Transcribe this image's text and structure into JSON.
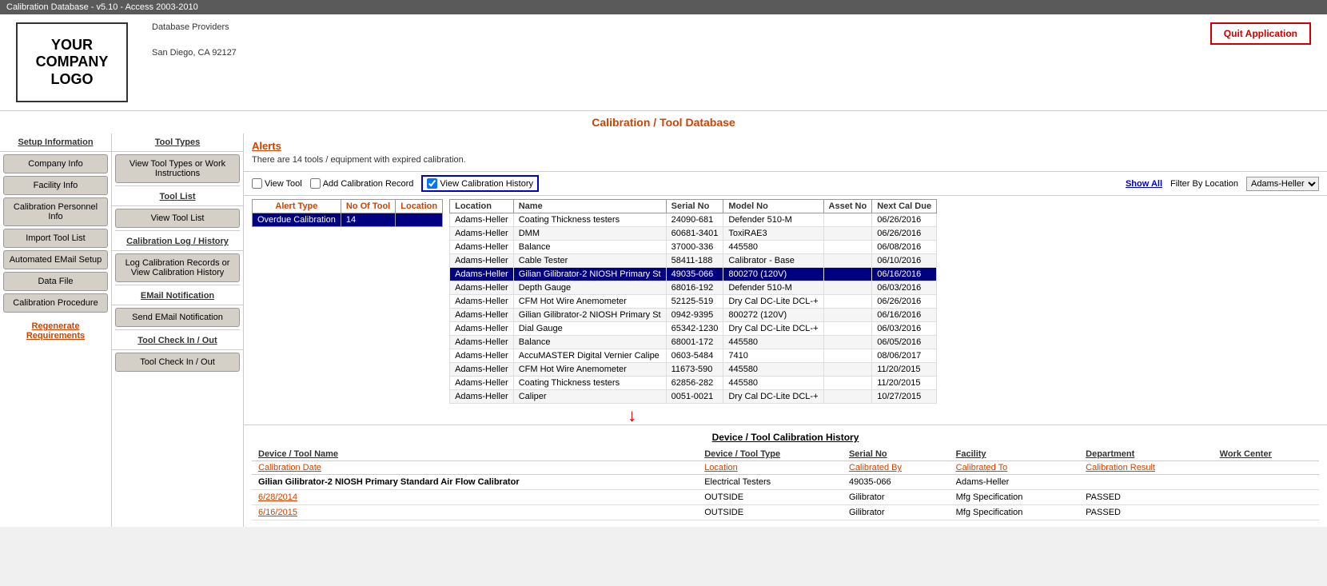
{
  "titleBar": {
    "text": "Calibration Database - v5.10 - Access 2003-2010"
  },
  "header": {
    "logo": "YOUR\nCOMPANY\nLOGO",
    "dbProviders": "Database Providers",
    "address": "San Diego,  CA  92127",
    "quitButton": "Quit Application"
  },
  "pageTitle": "Calibration / Tool Database",
  "leftSidebar": {
    "sectionHeader": "Setup Information",
    "buttons": [
      "Company Info",
      "Facility Info",
      "Calibration Personnel Info",
      "Import Tool List",
      "Automated EMail Setup",
      "Data File",
      "Calibration Procedure"
    ],
    "regenLink": "Regenerate Requirements"
  },
  "middleSidebar": {
    "toolTypesHeader": "Tool Types",
    "toolTypesBtn": "View Tool Types or Work Instructions",
    "toolListHeader": "Tool List",
    "toolListBtn": "View Tool List",
    "calLogHeader": "Calibration Log / History",
    "calLogBtn": "Log Calibration Records or View Calibration History",
    "emailHeader": "EMail Notification",
    "emailBtn": "Send EMail Notification",
    "toolCheckHeader1": "Tool Check In / Out",
    "toolCheckBtn1": "Tool Check In / Out"
  },
  "alerts": {
    "title": "Alerts",
    "message": "There are 14 tools / equipment with expired calibration."
  },
  "controls": {
    "viewToolLabel": "View Tool",
    "addCalRecordLabel": "Add Calibration Record",
    "viewCalHistoryLabel": "View Calibration History",
    "showAllLabel": "Show All",
    "filterByLocationLabel": "Filter By Location",
    "filterValue": "Adams-Heller"
  },
  "alertTable": {
    "headers": [
      "Alert Type",
      "No Of Tool",
      "Location"
    ],
    "rows": [
      {
        "type": "Overdue Calibration",
        "count": "14",
        "location": "",
        "selected": true
      }
    ]
  },
  "dataTable": {
    "headers": [
      "Name",
      "Serial No",
      "Model No",
      "Asset No",
      "Next Cal Due"
    ],
    "locationHeader": "Location",
    "rows": [
      {
        "location": "Adams-Heller",
        "name": "Coating Thickness testers",
        "serial": "24090-681",
        "model": "Defender 510-M",
        "asset": "",
        "nextCal": "06/26/2016"
      },
      {
        "location": "Adams-Heller",
        "name": "DMM",
        "serial": "60681-3401",
        "model": "ToxiRAE3",
        "asset": "",
        "nextCal": "06/26/2016"
      },
      {
        "location": "Adams-Heller",
        "name": "Balance",
        "serial": "37000-336",
        "model": "445580",
        "asset": "",
        "nextCal": "06/08/2016"
      },
      {
        "location": "Adams-Heller",
        "name": "Cable Tester",
        "serial": "58411-188",
        "model": "Calibrator - Base",
        "asset": "",
        "nextCal": "06/10/2016"
      },
      {
        "location": "Adams-Heller",
        "name": "Gilian Gilibrator-2 NIOSH Primary St",
        "serial": "49035-066",
        "model": "800270 (120V)",
        "asset": "",
        "nextCal": "06/16/2016",
        "selected": true
      },
      {
        "location": "Adams-Heller",
        "name": "Depth Gauge",
        "serial": "68016-192",
        "model": "Defender 510-M",
        "asset": "",
        "nextCal": "06/03/2016"
      },
      {
        "location": "Adams-Heller",
        "name": "CFM Hot Wire Anemometer",
        "serial": "52125-519",
        "model": "Dry Cal DC-Lite DCL-+",
        "asset": "",
        "nextCal": "06/26/2016"
      },
      {
        "location": "Adams-Heller",
        "name": "Gilian Gilibrator-2 NIOSH Primary St",
        "serial": "0942-9395",
        "model": "800272 (120V)",
        "asset": "",
        "nextCal": "06/16/2016"
      },
      {
        "location": "Adams-Heller",
        "name": "Dial Gauge",
        "serial": "65342-1230",
        "model": "Dry Cal DC-Lite DCL-+",
        "asset": "",
        "nextCal": "06/03/2016"
      },
      {
        "location": "Adams-Heller",
        "name": "Balance",
        "serial": "68001-172",
        "model": "445580",
        "asset": "",
        "nextCal": "06/05/2016"
      },
      {
        "location": "Adams-Heller",
        "name": "AccuMASTER Digital Vernier Calipe",
        "serial": "0603-5484",
        "model": "7410",
        "asset": "",
        "nextCal": "08/06/2017"
      },
      {
        "location": "Adams-Heller",
        "name": "CFM Hot Wire Anemometer",
        "serial": "11673-590",
        "model": "445580",
        "asset": "",
        "nextCal": "11/20/2015"
      },
      {
        "location": "Adams-Heller",
        "name": "Coating Thickness testers",
        "serial": "62856-282",
        "model": "445580",
        "asset": "",
        "nextCal": "11/20/2015"
      },
      {
        "location": "Adams-Heller",
        "name": "Caliper",
        "serial": "0051-0021",
        "model": "Dry Cal DC-Lite DCL-+",
        "asset": "",
        "nextCal": "10/27/2015"
      }
    ]
  },
  "calHistory": {
    "title": "Device / Tool Calibration History",
    "colHeaders": {
      "deviceName": "Device / Tool Name",
      "deviceType": "Device / Tool Type",
      "serialNo": "Serial No",
      "facility": "Facility",
      "department": "Department",
      "workCenter": "Work Center"
    },
    "subHeaders": {
      "calDate": "Calibration Date",
      "location": "Location",
      "calibratedBy": "Calibrated By",
      "calibratedTo": "Calibrated To",
      "calResult": "Calibration Result"
    },
    "deviceName": "Gilian Gilibrator-2 NIOSH Primary Standard Air Flow Calibrator",
    "deviceType": "Electrical Testers",
    "serialNo": "49035-066",
    "facility": "Adams-Heller",
    "rows": [
      {
        "date": "6/28/2014",
        "location": "OUTSIDE",
        "calibratedBy": "Gilibrator",
        "calibratedTo": "Mfg Specification",
        "result": "PASSED"
      },
      {
        "date": "6/16/2015",
        "location": "OUTSIDE",
        "calibratedBy": "Gilibrator",
        "calibratedTo": "Mfg Specification",
        "result": "PASSED"
      }
    ]
  }
}
